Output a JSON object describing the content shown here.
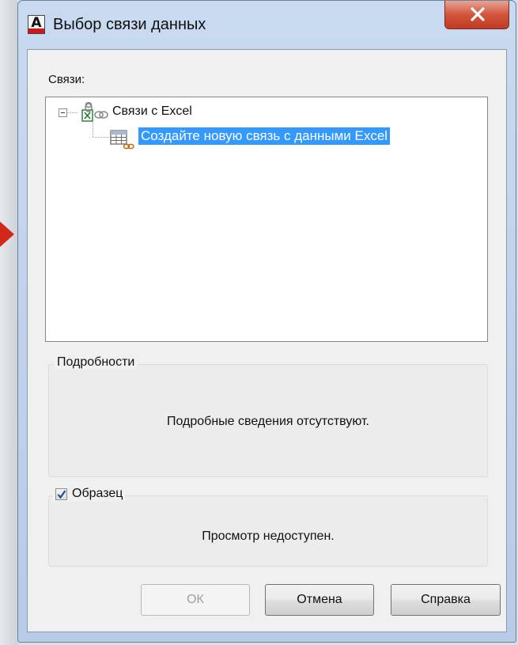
{
  "window": {
    "title": "Выбор связи данных",
    "app_icon_letter": "A",
    "close_glyph": "✕"
  },
  "links_panel": {
    "label": "Связи:",
    "tree": {
      "root_label": "Связи с Excel",
      "root_icon": "excel-link-icon",
      "child_label": "Создайте новую связь с данными Excel",
      "child_icon": "table-link-icon"
    }
  },
  "details": {
    "legend": "Подробности",
    "text": "Подробные сведения отсутствуют."
  },
  "sample": {
    "legend": "Образец",
    "checked": true,
    "text": "Просмотр недоступен."
  },
  "buttons": {
    "ok_label": "ОК",
    "cancel_label": "Отмена",
    "help_label": "Справка"
  },
  "colors": {
    "selection": "#3399ff",
    "close_button": "#c8402a",
    "background_arrow": "#d2281c"
  }
}
